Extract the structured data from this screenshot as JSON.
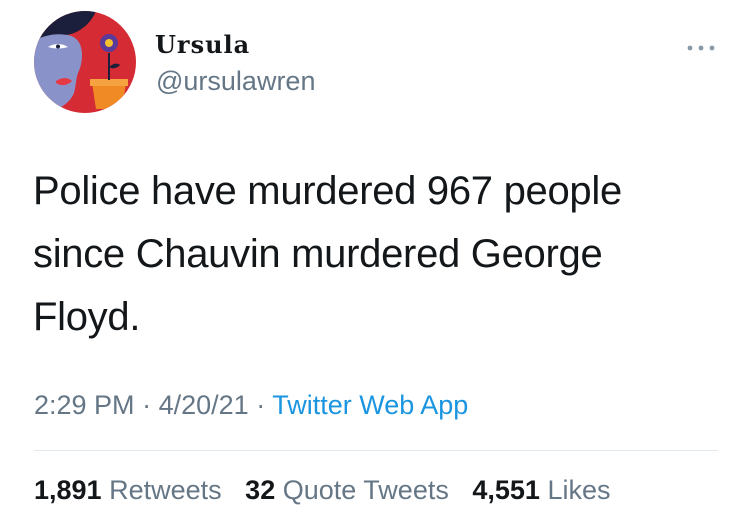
{
  "user": {
    "display_name": "Ursula",
    "handle": "@ursulawren"
  },
  "tweet": {
    "text": "Police have murdered 967 people since Chauvin murdered George Floyd."
  },
  "meta": {
    "time": "2:29 PM",
    "separator": "·",
    "date": "4/20/21",
    "source": "Twitter Web App"
  },
  "stats": {
    "retweets_count": "1,891",
    "retweets_label": "Retweets",
    "quotes_count": "32",
    "quotes_label": "Quote Tweets",
    "likes_count": "4,551",
    "likes_label": "Likes"
  },
  "icons": {
    "more": "more-horizontal-icon"
  },
  "colors": {
    "text": "#14171a",
    "secondary": "#657786",
    "link": "#1b95e0",
    "avatar_background": "#d52b35",
    "avatar_face": "#8a93c9"
  }
}
